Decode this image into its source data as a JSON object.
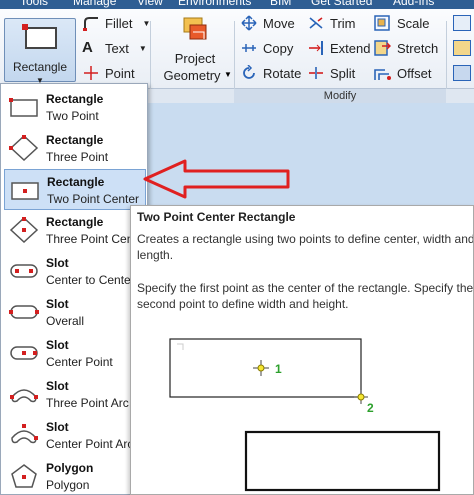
{
  "menu_tabs": [
    "Tools",
    "Manage",
    "View",
    "Environments",
    "BIM",
    "Get Started",
    "Add-Ins"
  ],
  "ribbon": {
    "rectangle_button": {
      "label": "Rectangle",
      "icon": "rectangle-icon"
    },
    "draw_tools": [
      {
        "label": "Fillet",
        "icon": "fillet-icon",
        "has_dropdown": true
      },
      {
        "label": "Text",
        "icon": "text-icon",
        "has_dropdown": true
      },
      {
        "label": "Point",
        "icon": "point-icon",
        "has_dropdown": false
      }
    ],
    "project_geometry": {
      "label_line1": "Project",
      "label_line2": "Geometry",
      "icon": "project-geometry-icon"
    },
    "modify_tools": [
      {
        "label": "Move",
        "icon": "move-icon"
      },
      {
        "label": "Trim",
        "icon": "trim-icon"
      },
      {
        "label": "Scale",
        "icon": "scale-icon"
      },
      {
        "label": "Copy",
        "icon": "copy-icon"
      },
      {
        "label": "Extend",
        "icon": "extend-icon"
      },
      {
        "label": "Stretch",
        "icon": "stretch-icon"
      },
      {
        "label": "Rotate",
        "icon": "rotate-icon"
      },
      {
        "label": "Split",
        "icon": "split-icon"
      },
      {
        "label": "Offset",
        "icon": "offset-icon"
      }
    ],
    "group_label": "Modify"
  },
  "dropdown_items": [
    {
      "title": "Rectangle",
      "subtitle": "Two Point",
      "icon": "rectangle-two-point-icon"
    },
    {
      "title": "Rectangle",
      "subtitle": "Three Point",
      "icon": "rectangle-three-point-icon"
    },
    {
      "title": "Rectangle",
      "subtitle": "Two Point Center",
      "icon": "rectangle-two-point-center-icon",
      "selected": true
    },
    {
      "title": "Rectangle",
      "subtitle": "Three Point Cente",
      "icon": "rectangle-three-point-center-icon"
    },
    {
      "title": "Slot",
      "subtitle": "Center to Cente",
      "icon": "slot-center-to-center-icon"
    },
    {
      "title": "Slot",
      "subtitle": "Overall",
      "icon": "slot-overall-icon"
    },
    {
      "title": "Slot",
      "subtitle": "Center Point",
      "icon": "slot-center-point-icon"
    },
    {
      "title": "Slot",
      "subtitle": "Three Point Arc",
      "icon": "slot-three-point-arc-icon"
    },
    {
      "title": "Slot",
      "subtitle": "Center Point Arc",
      "icon": "slot-center-point-arc-icon"
    },
    {
      "title": "Polygon",
      "subtitle": "Polygon",
      "icon": "polygon-icon"
    }
  ],
  "tooltip": {
    "title": "Two Point Center Rectangle",
    "para1": "Creates a rectangle using two points to define center, width and length.",
    "para2": "Specify the first point as the center of the rectangle. Specify the second point to define width and height.",
    "point1_label": "1",
    "point2_label": "2"
  },
  "colors": {
    "accent": "#d31f1f",
    "arrow": "#e02020",
    "selection": "#cde0f6",
    "point_label": "#2ca02c"
  }
}
